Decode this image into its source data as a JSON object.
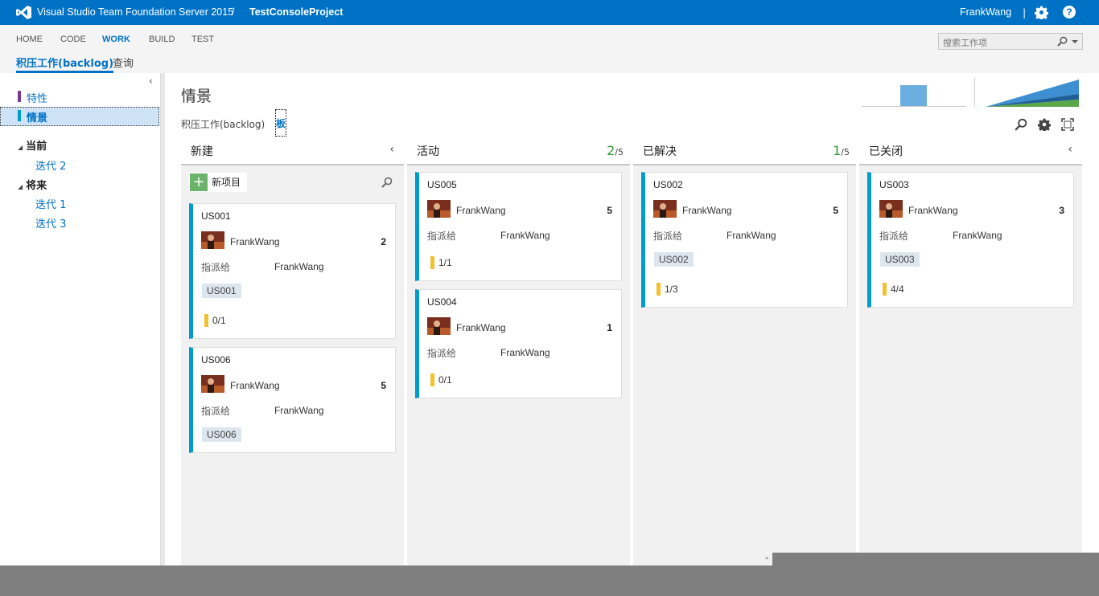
{
  "topbar": {
    "product": "Visual Studio Team Foundation Server 2015",
    "separator": "/",
    "project": "TestConsoleProject",
    "user": "FrankWang",
    "user_separator": "|",
    "help": "?"
  },
  "hubs": [
    "HOME",
    "CODE",
    "WORK",
    "BUILD",
    "TEST"
  ],
  "subnav": {
    "backlog": "积压工作(backlog)",
    "queries": "查询"
  },
  "search": {
    "placeholder": "搜索工作项"
  },
  "left": {
    "items": [
      {
        "label": "特性",
        "color": "#773b93"
      },
      {
        "label": "情景",
        "color": "#009ccc"
      }
    ],
    "current": "当前",
    "current_iters": [
      "迭代 2"
    ],
    "future": "将来",
    "future_iters": [
      "迭代 1",
      "迭代 3"
    ]
  },
  "main": {
    "title": "情景",
    "view_backlog": "积压工作(backlog)",
    "view_board": "板"
  },
  "board": {
    "new_item": "新项目",
    "assigned_label": "指派给",
    "columns": [
      {
        "title": "新建"
      },
      {
        "title": "活动",
        "wip_current": "2",
        "wip_limit": "/5"
      },
      {
        "title": "已解决",
        "wip_current": "1",
        "wip_limit": "/5"
      },
      {
        "title": "已关闭"
      }
    ],
    "cards": {
      "US001": {
        "id": "US001",
        "owner": "FrankWang",
        "effort": "2",
        "assigned": "FrankWang",
        "tag": "US001",
        "tasks": "0/1"
      },
      "US006": {
        "id": "US006",
        "owner": "FrankWang",
        "effort": "5",
        "assigned": "FrankWang",
        "tag": "US006"
      },
      "US005": {
        "id": "US005",
        "owner": "FrankWang",
        "effort": "5",
        "assigned": "FrankWang",
        "tasks": "1/1"
      },
      "US004": {
        "id": "US004",
        "owner": "FrankWang",
        "effort": "1",
        "assigned": "FrankWang",
        "tasks": "0/1"
      },
      "US002": {
        "id": "US002",
        "owner": "FrankWang",
        "effort": "5",
        "assigned": "FrankWang",
        "tag": "US002",
        "tasks": "1/3"
      },
      "US003": {
        "id": "US003",
        "owner": "FrankWang",
        "effort": "3",
        "assigned": "FrankWang",
        "tag": "US003",
        "tasks": "4/4"
      }
    }
  },
  "colors": {
    "brand": "#0072c6",
    "story": "#009ccc",
    "wip": "#339933",
    "task_bar": "#f2c12e"
  },
  "bottom_mark": "»"
}
